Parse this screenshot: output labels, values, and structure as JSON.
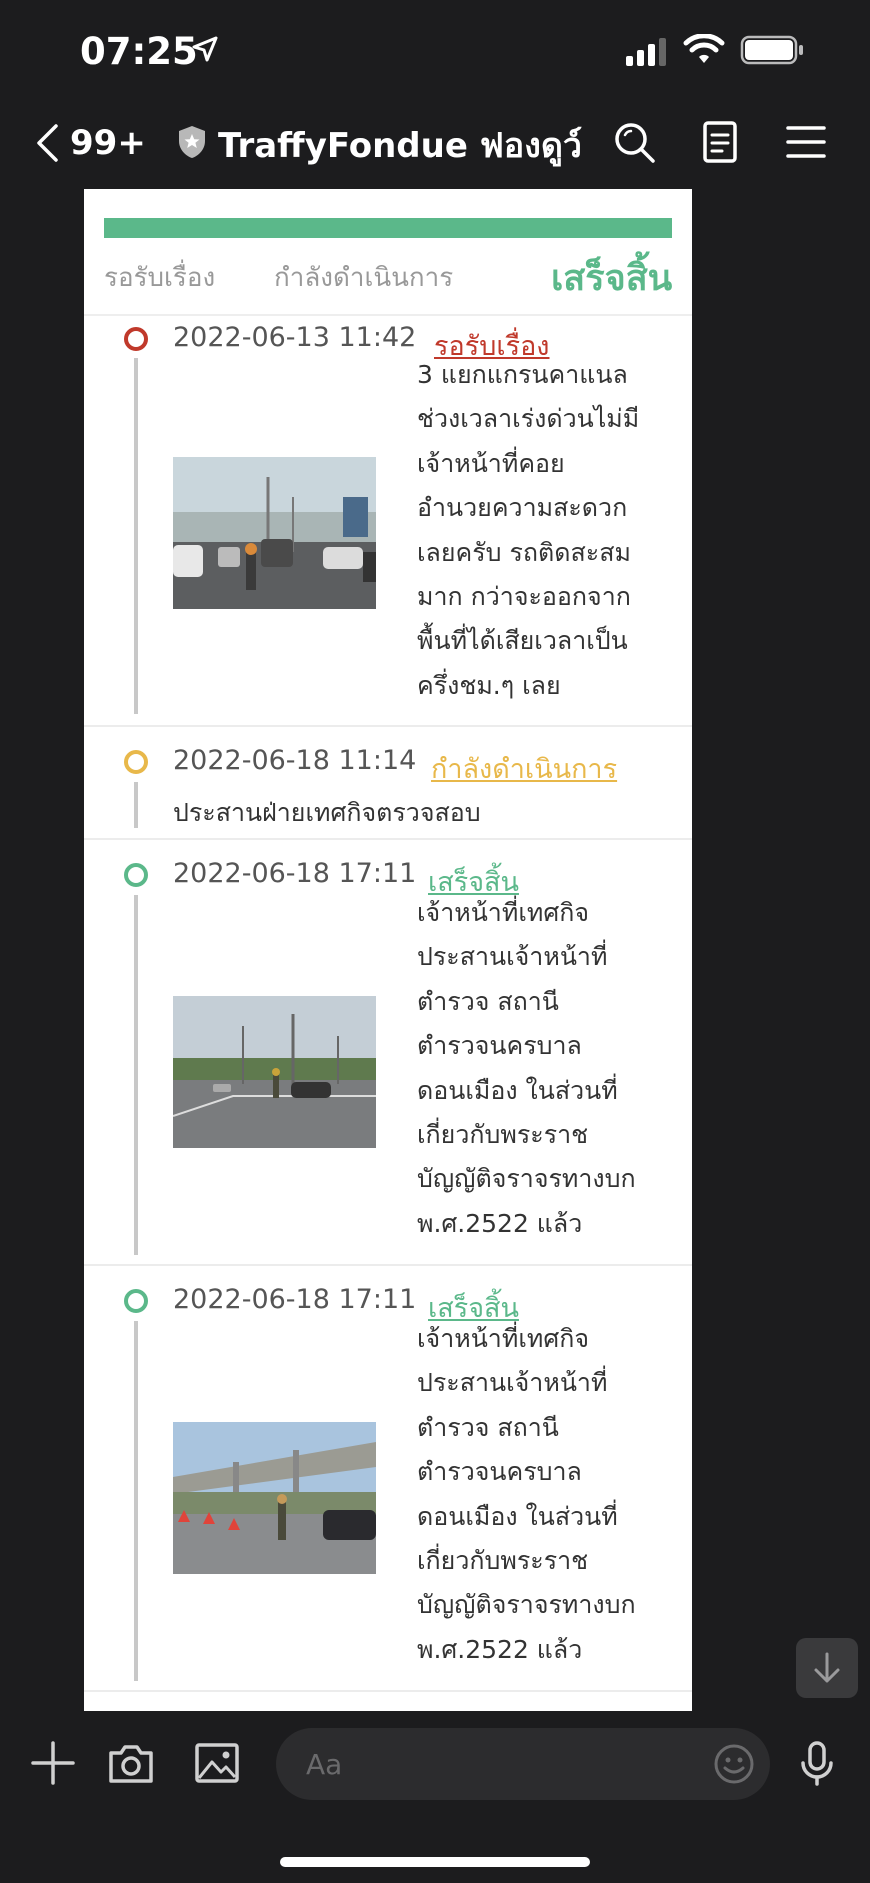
{
  "status_bar": {
    "time": "07:25"
  },
  "header": {
    "back_count": "99+",
    "title": "TraffyFondue ฟองดูว์",
    "icons": [
      "search-icon",
      "notes-icon",
      "menu-icon"
    ]
  },
  "progress": {
    "fill_fraction": 1.0,
    "color": "#5bb88a",
    "steps": [
      "รอรับเรื่อง",
      "กำลังดำเนินการ",
      "เสร็จสิ้น"
    ],
    "current_step": "เสร็จสิ้น"
  },
  "colors": {
    "received": "#c0392b",
    "in_progress": "#e8b84a",
    "done": "#5bb88a"
  },
  "timeline": [
    {
      "timestamp": "2022-06-13 11:42",
      "status": "รอรับเรื่อง",
      "description": "3 แยกแกรนคาแนล ช่วงเวลาเร่งด่วนไม่มีเจ้าหน้าที่คอยอำนวยความสะดวกเลยครับ รถติดสะสมมาก กว่าจะออกจากพื้นที่ได้เสียเวลาเป็นครึ่งชม.ๆ เลย",
      "lines": [
        "3 แยกแกรนคาแนล",
        "ช่วงเวลาเร่งด่วนไม่มี",
        "เจ้าหน้าที่คอย",
        "อำนวยความสะดวก",
        "เลยครับ รถติดสะสม",
        "มาก กว่าจะออกจาก",
        "พื้นที่ได้เสียเวลาเป็น",
        "ครึ่งชม.ๆ เลย"
      ]
    },
    {
      "timestamp": "2022-06-18 11:14",
      "status": "กำลังดำเนินการ",
      "description": "ประสานฝ่ายเทศกิจตรวจสอบ"
    },
    {
      "timestamp": "2022-06-18 17:11",
      "status": "เสร็จสิ้น",
      "description": "เจ้าหน้าที่เทศกิจประสานเจ้าหน้าที่ตำรวจ สถานีตำรวจนครบาลดอนเมือง ในส่วนที่เกี่ยวกับพระราชบัญญัติจราจรทางบก พ.ศ.2522 แล้ว",
      "lines": [
        "เจ้าหน้าที่เทศกิจ",
        "ประสานเจ้าหน้าที่",
        "ตำรวจ สถานี",
        "ตำรวจนครบาล",
        "ดอนเมือง ในส่วนที่",
        "เกี่ยวกับพระราช",
        "บัญญัติจราจรทางบก",
        "พ.ศ.2522 แล้ว"
      ]
    },
    {
      "timestamp": "2022-06-18 17:11",
      "status": "เสร็จสิ้น",
      "description": "เจ้าหน้าที่เทศกิจประสานเจ้าหน้าที่ตำรวจ สถานีตำรวจนครบาลดอนเมือง ในส่วนที่เกี่ยวกับพระราชบัญญัติจราจรทางบก พ.ศ.2522 แล้ว",
      "lines": [
        "เจ้าหน้าที่เทศกิจ",
        "ประสานเจ้าหน้าที่",
        "ตำรวจ สถานี",
        "ตำรวจนครบาล",
        "ดอนเมือง ในส่วนที่",
        "เกี่ยวกับพระราช",
        "บัญญัติจราจรทางบก",
        "พ.ศ.2522 แล้ว"
      ]
    }
  ],
  "composer": {
    "placeholder": "Aa",
    "icons": [
      "plus-icon",
      "camera-icon",
      "image-icon",
      "emoji-icon",
      "microphone-icon"
    ]
  }
}
